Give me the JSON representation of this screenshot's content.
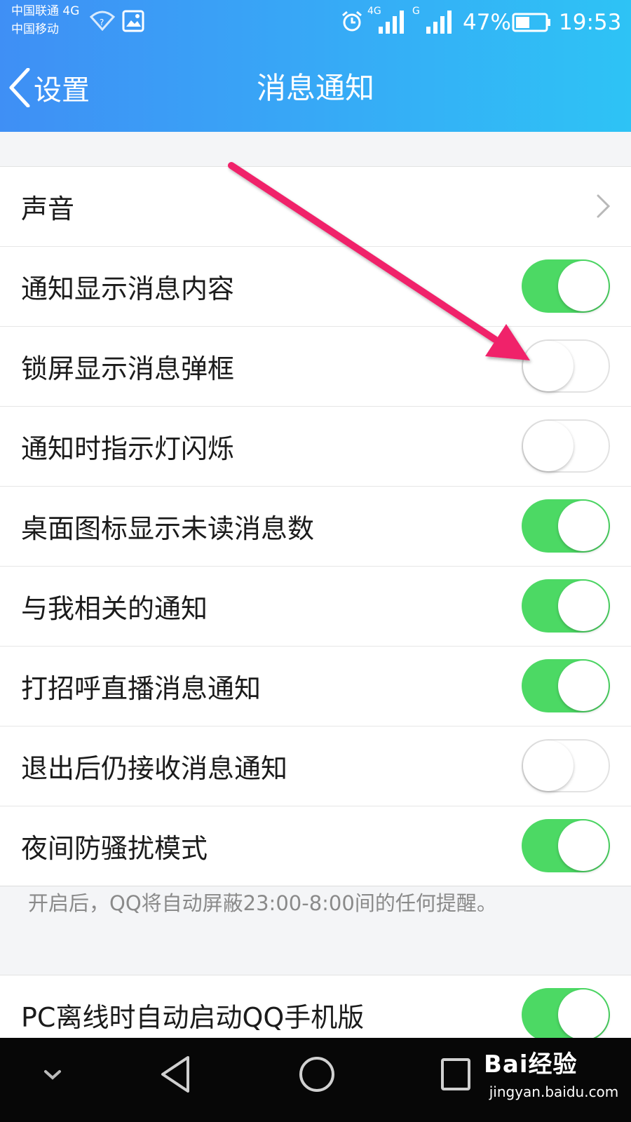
{
  "status_bar": {
    "carrier_1": "中国联通 4G",
    "carrier_2": "中国移动",
    "network_1": "4G",
    "network_2": "G",
    "battery": "47%",
    "battery_level": 0.47,
    "time": "19:53",
    "icons": [
      "wifi-icon",
      "gallery-icon",
      "alarm-icon",
      "signal-icon",
      "battery-icon"
    ]
  },
  "nav": {
    "back_label": "设置",
    "title": "消息通知"
  },
  "settings": [
    {
      "label": "声音",
      "type": "link"
    },
    {
      "label": "通知显示消息内容",
      "type": "toggle",
      "on": true
    },
    {
      "label": "锁屏显示消息弹框",
      "type": "toggle",
      "on": false
    },
    {
      "label": "通知时指示灯闪烁",
      "type": "toggle",
      "on": false
    },
    {
      "label": "桌面图标显示未读消息数",
      "type": "toggle",
      "on": true
    },
    {
      "label": "与我相关的通知",
      "type": "toggle",
      "on": true
    },
    {
      "label": "打招呼直播消息通知",
      "type": "toggle",
      "on": true
    },
    {
      "label": "退出后仍接收消息通知",
      "type": "toggle",
      "on": false
    },
    {
      "label": "夜间防骚扰模式",
      "type": "toggle",
      "on": true
    }
  ],
  "footnote": "开启后，QQ将自动屏蔽23:00-8:00间的任何提醒。",
  "settings_2": [
    {
      "label": "PC离线时自动启动QQ手机版",
      "type": "toggle",
      "on": true
    }
  ],
  "colors": {
    "header_start": "#3f8ff5",
    "header_end": "#2ec3f5",
    "toggle_on": "#4cd964",
    "annotation_arrow": "#f0226b"
  },
  "watermark": {
    "logo": "Bai经验",
    "url": "jingyan.baidu.com"
  }
}
